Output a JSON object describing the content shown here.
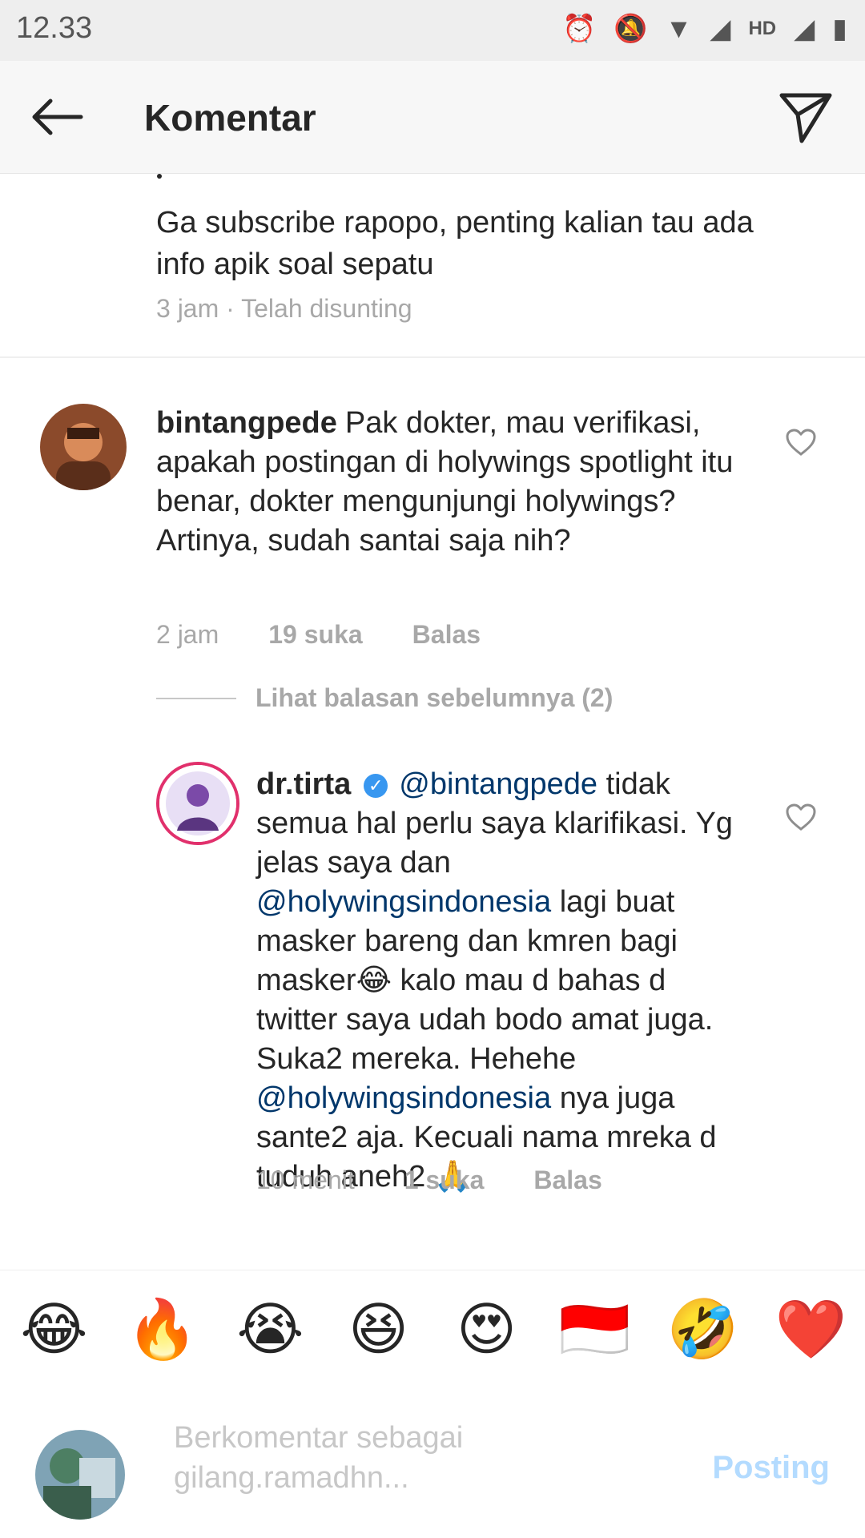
{
  "status_bar": {
    "time": "12.33",
    "icons": [
      "alarm-icon",
      "mute-icon",
      "wifi-icon",
      "signal-icon",
      "hd-icon",
      "signal-icon",
      "battery-icon"
    ],
    "hd_label": "HD"
  },
  "header": {
    "title": "Komentar",
    "back_icon": "arrow-left-icon",
    "share_icon": "send-icon"
  },
  "previous_comment": {
    "text": "Ga subscribe rapopo, penting kalian tau ada info apik soal sepatu",
    "meta": "3 jam · Telah disunting"
  },
  "comments": [
    {
      "username": "bintangpede",
      "text": "Pak dokter, mau verifikasi, apakah postingan di holywings spotlight itu benar, dokter mengunjungi holywings? Artinya, sudah santai saja nih?",
      "time": "2 jam",
      "likes": "19 suka",
      "reply": "Balas"
    },
    {
      "username": "dr.tirta",
      "verified": true,
      "mention": "@bintangpede",
      "text_1": "tidak semua hal perlu saya klarifikasi. Yg jelas saya dan",
      "mention_2": "@holywingsindonesia",
      "text_2": "lagi buat masker bareng dan kmren bagi masker😂 kalo mau d bahas d twitter saya udah bodo amat juga. Suka2 mereka. Hehehe",
      "mention_3": "@holywingsindonesia",
      "text_3": "nya juga sante2 aja. Kecuali nama mreka d tuduh aneh2 🙏",
      "time": "10 menit",
      "likes": "1 suka",
      "reply": "Balas"
    }
  ],
  "view_replies": "Lihat balasan sebelumnya (2)",
  "emoji_bar": [
    "😂",
    "🔥",
    "😭",
    "😆",
    "😍",
    "🇮🇩",
    "🤣",
    "❤️"
  ],
  "composer": {
    "placeholder": "Berkomentar sebagai gilang.ramadhn...",
    "post_label": "Posting"
  },
  "colors": {
    "accent": "#3897f0",
    "mention": "#00376b",
    "muted": "#a8a8a8",
    "post_disabled": "#b3dbff"
  }
}
